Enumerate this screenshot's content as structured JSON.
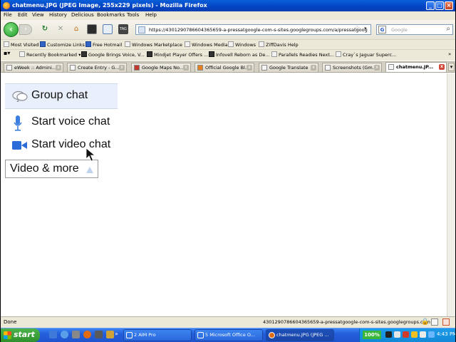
{
  "window": {
    "title": "chatmenu.JPG (JPEG Image, 255x229 pixels) - Mozilla Firefox"
  },
  "menu": [
    "File",
    "Edit",
    "View",
    "History",
    "Delicious",
    "Bookmarks",
    "Tools",
    "Help"
  ],
  "nav": {
    "url": "https://4301290786604365659-a-pressatgoogle-com-s-sites.googlegroups.com/a/pressatgoog",
    "search_placeholder": "Google"
  },
  "bookmarks": [
    "Most Visited",
    "Customize Links",
    "Free Hotmail",
    "Windows Marketplace",
    "Windows Media",
    "Windows",
    "ZiffDavis Help"
  ],
  "toolbar_items": [
    "Recently Bookmarked",
    "Google Brings Voice, V...",
    "Mindjet Player Offers ...",
    "Infovell Reborn as De...",
    "Parallels Readies Next...",
    "Cray`s Jaguar Superc..."
  ],
  "tabs": [
    "eWeek :: Admini...",
    "Create Entry - G...",
    "Google Maps No...",
    "Official Google Bl...",
    "Google Translate",
    "Screenshots (Gm...",
    "chatmenu.JP..."
  ],
  "content": {
    "group_chat": "Group chat",
    "voice_chat": "Start voice chat",
    "video_chat": "Start video chat",
    "video_more": "Video & more"
  },
  "status": {
    "text": "Done",
    "url": "4301290786604365659-a-pressatgoogle-com-s-sites.googlegroups.com"
  },
  "taskbar": {
    "start": "start",
    "tasks": [
      "2 AIM Pro",
      "5 Microsoft Office O...",
      "chatmenu.JPG (JPEG ..."
    ],
    "battery": "100%",
    "clock": "4:43 PM"
  },
  "colors": {
    "titlebar": "#0343c4",
    "group_chat_bg": "#e9f0fb",
    "voice_icon": "#3d7fe0",
    "video_icon": "#2b6cd8",
    "start_green": "#2f8f2c"
  },
  "icons": [
    "firefox-icon",
    "back-arrow-icon",
    "forward-arrow-icon",
    "reload-icon",
    "stop-icon",
    "home-icon",
    "star-icon",
    "google-icon",
    "search-icon",
    "chat-bubble-icon",
    "microphone-icon",
    "video-camera-icon",
    "mouse-cursor-icon",
    "windows-flag-icon",
    "lock-icon"
  ]
}
